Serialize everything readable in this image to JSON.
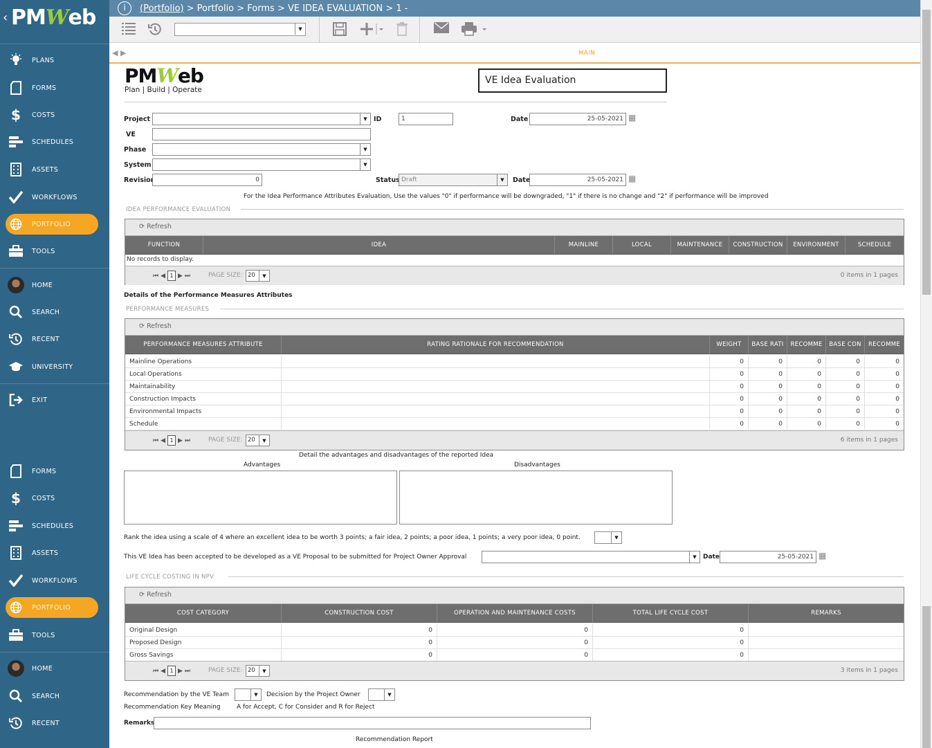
{
  "brand": {
    "logo_text_a": "PM",
    "logo_text_b": "W",
    "logo_text_c": "eb"
  },
  "nav_top": [
    {
      "label": "PLANS",
      "icon": "lightbulb-icon"
    },
    {
      "label": "FORMS",
      "icon": "forms-icon"
    },
    {
      "label": "COSTS",
      "icon": "dollar-icon"
    },
    {
      "label": "SCHEDULES",
      "icon": "schedules-icon"
    },
    {
      "label": "ASSETS",
      "icon": "building-icon"
    },
    {
      "label": "WORKFLOWS",
      "icon": "check-icon"
    },
    {
      "label": "PORTFOLIO",
      "icon": "globe-icon",
      "active": true
    },
    {
      "label": "TOOLS",
      "icon": "toolbox-icon"
    }
  ],
  "nav_user": [
    {
      "label": "HOME",
      "icon": "avatar"
    },
    {
      "label": "SEARCH",
      "icon": "search-icon"
    },
    {
      "label": "RECENT",
      "icon": "recent-icon"
    },
    {
      "label": "UNIVERSITY",
      "icon": "graduation-cap-icon"
    }
  ],
  "nav_exit": {
    "label": "EXIT",
    "icon": "exit-icon"
  },
  "nav_bottom": [
    {
      "label": "FORMS"
    },
    {
      "label": "COSTS"
    },
    {
      "label": "SCHEDULES"
    },
    {
      "label": "ASSETS"
    },
    {
      "label": "WORKFLOWS"
    },
    {
      "label": "PORTFOLIO",
      "active": true
    },
    {
      "label": "TOOLS"
    },
    {
      "label": "HOME"
    },
    {
      "label": "SEARCH"
    },
    {
      "label": "RECENT"
    }
  ],
  "breadcrumb": {
    "link": "(Portfolio)",
    "rest": "> Portfolio > Forms > VE IDEA EVALUATION > 1 -"
  },
  "tabs": {
    "main": "MAIN"
  },
  "form": {
    "logo_tagline": "Plan | Build | Operate",
    "title": "VE Idea Evaluation",
    "project_label": "Project",
    "id_label": "ID",
    "id_value": "1",
    "date_label": "Date",
    "date_value": "25-05-2021",
    "ve_label": "VE",
    "phase_label": "Phase",
    "system_label": "System",
    "revision_label": "Revision",
    "revision_value": "0",
    "status_label": "Status",
    "status_value": "Draft",
    "date2_label": "Date",
    "date2_value": "25-05-2021",
    "instructions": "For the Idea Performance Attributes Evaluation, Use the values \"0\" if performance will be downgraded, \"1\" if there is no change and \"2\" if performance will be improved"
  },
  "idea_grid": {
    "section": "IDEA PERFORMANCE EVALUATION",
    "refresh": "Refresh",
    "columns": [
      "FUNCTION",
      "IDEA",
      "MAINLINE",
      "LOCAL",
      "MAINTENANCE",
      "CONSTRUCTION",
      "ENVIRONMENT",
      "SCHEDULE"
    ],
    "empty": "No records to display.",
    "page": "1",
    "page_size_label": "PAGE SIZE:",
    "page_size": "20",
    "count": "0 items in 1 pages"
  },
  "pm_details_label": "Details of the Performance Measures Attributes",
  "pm_grid": {
    "section": "PERFORMANCE MEASURES",
    "refresh": "Refresh",
    "columns": [
      "PERFORMANCE MEASURES ATTRIBUTE",
      "RATING RATIONALE FOR RECOMMENDATION",
      "WEIGHT",
      "BASE RATI",
      "RECOMME",
      "BASE CON",
      "RECOMME"
    ],
    "rows": [
      [
        "Mainline Operations",
        "",
        "0",
        "0",
        "0",
        "0",
        "0"
      ],
      [
        "Local Operations",
        "",
        "0",
        "0",
        "0",
        "0",
        "0"
      ],
      [
        "Maintainability",
        "",
        "0",
        "0",
        "0",
        "0",
        "0"
      ],
      [
        "Construction Impacts",
        "",
        "0",
        "0",
        "0",
        "0",
        "0"
      ],
      [
        "Environmental Impacts",
        "",
        "0",
        "0",
        "0",
        "0",
        "0"
      ],
      [
        "Schedule",
        "",
        "0",
        "0",
        "0",
        "0",
        "0"
      ]
    ],
    "page": "1",
    "page_size_label": "PAGE SIZE:",
    "page_size": "20",
    "count": "6 items in 1 pages"
  },
  "adv": {
    "heading": "Detail the advantages and disadvantages of the reported Idea",
    "advantages": "Advantages",
    "disadvantages": "Disadvantages"
  },
  "rank_label": "Rank the idea using a scale of 4 where an excellent idea to be worth 3 points; a fair idea, 2 points; a poor idea, 1 points; a very poor idea, 0 point.",
  "accepted_label": "This VE Idea has been accepted to be developed as a VE Proposal to be submitted for Project Owner Approval",
  "accepted_date_label": "Date",
  "accepted_date_value": "25-05-2021",
  "lcc_grid": {
    "section": "LIFE CYCLE COSTING IN NPV",
    "refresh": "Refresh",
    "columns": [
      "COST CATEGORY",
      "CONSTRUCTION COST",
      "OPERATION AND MAINTENANCE COSTS",
      "TOTAL LIFE CYCLE COST",
      "REMARKS"
    ],
    "rows": [
      [
        "Original Design",
        "0",
        "0",
        "0",
        ""
      ],
      [
        "Proposed Design",
        "0",
        "0",
        "0",
        ""
      ],
      [
        "Gross Savings",
        "0",
        "0",
        "0",
        ""
      ]
    ],
    "page": "1",
    "page_size_label": "PAGE SIZE:",
    "page_size": "20",
    "count": "3 items in 1 pages"
  },
  "recommendation": {
    "ve_team_label": "Recommendation by the VE Team",
    "owner_label": "Decision by the Project Owner",
    "key_label": "Recommendation Key Meaning",
    "key_value": "A for Accept, C for Consider and R for Reject",
    "remarks_label": "Remarks",
    "report_label": "Recommendation Report"
  }
}
